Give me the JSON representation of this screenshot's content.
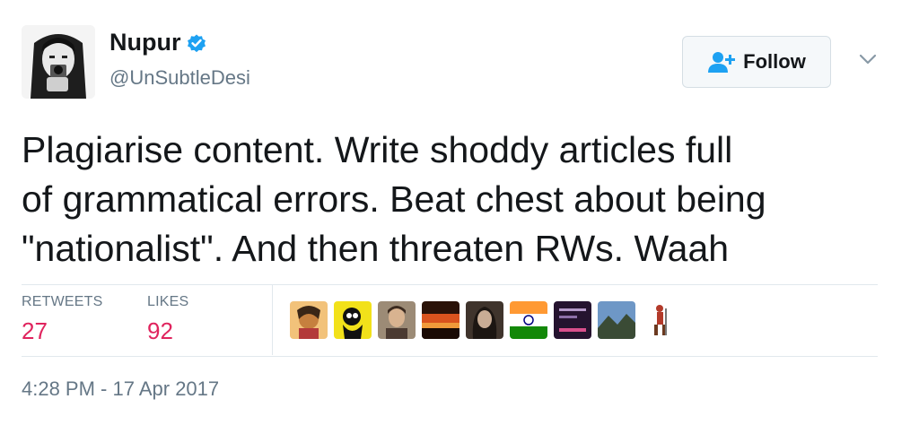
{
  "user": {
    "display_name": "Nupur",
    "handle": "@UnSubtleDesi",
    "verified": true
  },
  "follow_button": {
    "label": "Follow"
  },
  "tweet": {
    "lines": [
      "Plagiarise content. Write shoddy articles full",
      "of grammatical errors. Beat chest about being",
      "\"nationalist\". And then threaten RWs. Waah"
    ]
  },
  "stats": {
    "retweets_label": "RETWEETS",
    "retweets_count": "27",
    "likes_label": "LIKES",
    "likes_count": "92"
  },
  "likers": [
    {
      "name": "liker-avatar-1",
      "color": "#d9a25a"
    },
    {
      "name": "liker-avatar-2",
      "color": "#e8d21c"
    },
    {
      "name": "liker-avatar-3",
      "color": "#8a6e55"
    },
    {
      "name": "liker-avatar-4",
      "color": "#b24a1f"
    },
    {
      "name": "liker-avatar-5",
      "color": "#5b4a3d"
    },
    {
      "name": "liker-avatar-6",
      "color": "#ff9933"
    },
    {
      "name": "liker-avatar-7",
      "color": "#3b1e4a"
    },
    {
      "name": "liker-avatar-8",
      "color": "#5d7a93"
    },
    {
      "name": "liker-avatar-9",
      "color": "#ffffff"
    }
  ],
  "timestamp": "4:28 PM - 17 Apr 2017",
  "colors": {
    "verified_blue": "#1da1f2",
    "like_count": "#e0245e",
    "muted_text": "#657786"
  }
}
